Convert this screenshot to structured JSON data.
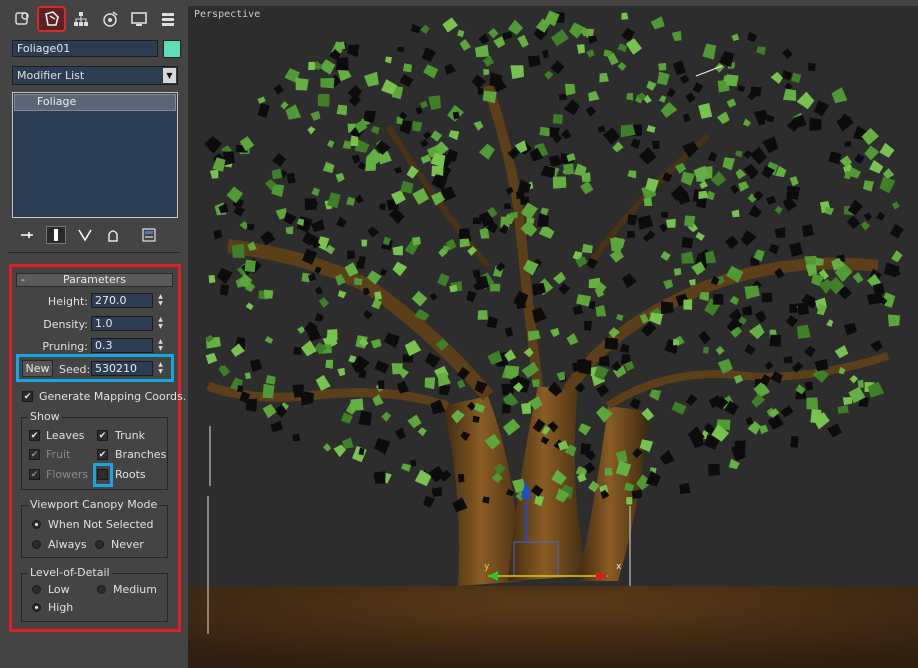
{
  "command_panel": {
    "tabs": [
      {
        "name": "create-tab",
        "icon": "create-icon"
      },
      {
        "name": "modify-tab",
        "icon": "modify-icon",
        "active": true
      },
      {
        "name": "hierarchy-tab",
        "icon": "hierarchy-icon"
      },
      {
        "name": "motion-tab",
        "icon": "motion-icon"
      },
      {
        "name": "display-tab",
        "icon": "display-icon"
      },
      {
        "name": "utilities-tab",
        "icon": "utilities-icon"
      }
    ],
    "object_name": "Foliage01",
    "object_color": "#5fdcb8",
    "modifier_list_label": "Modifier List",
    "stack_item": "Foliage"
  },
  "parameters": {
    "rollout_title": "Parameters",
    "collapse_symbol": "-",
    "height_label": "Height:",
    "height_value": "270.0",
    "density_label": "Density:",
    "density_value": "1.0",
    "pruning_label": "Pruning:",
    "pruning_value": "0.3",
    "new_label": "New",
    "seed_label": "Seed:",
    "seed_value": "530210",
    "mapping_label": "Generate Mapping Coords.",
    "mapping_checked": true
  },
  "show": {
    "title": "Show",
    "leaves": {
      "label": "Leaves",
      "checked": true,
      "enabled": true
    },
    "trunk": {
      "label": "Trunk",
      "checked": true,
      "enabled": true
    },
    "fruit": {
      "label": "Fruit",
      "checked": true,
      "enabled": false
    },
    "branches": {
      "label": "Branches",
      "checked": true,
      "enabled": true
    },
    "flowers": {
      "label": "Flowers",
      "checked": true,
      "enabled": false
    },
    "roots": {
      "label": "Roots",
      "checked": false,
      "enabled": true
    }
  },
  "canopy": {
    "title": "Viewport Canopy Mode",
    "when_not_selected": "When Not Selected",
    "always": "Always",
    "never": "Never",
    "selected": "when_not_selected"
  },
  "lod": {
    "title": "Level-of-Detail",
    "low": "Low",
    "medium": "Medium",
    "high": "High",
    "selected": "high"
  },
  "viewport": {
    "label": "Perspective",
    "background": "#2d2d2d",
    "axis_x": "x",
    "axis_y": "y"
  },
  "colors": {
    "highlight_red": "#e01f26",
    "highlight_blue": "#16a6e0",
    "leaf_green": "#5da63c",
    "trunk_brown": "#6b4a1e"
  }
}
